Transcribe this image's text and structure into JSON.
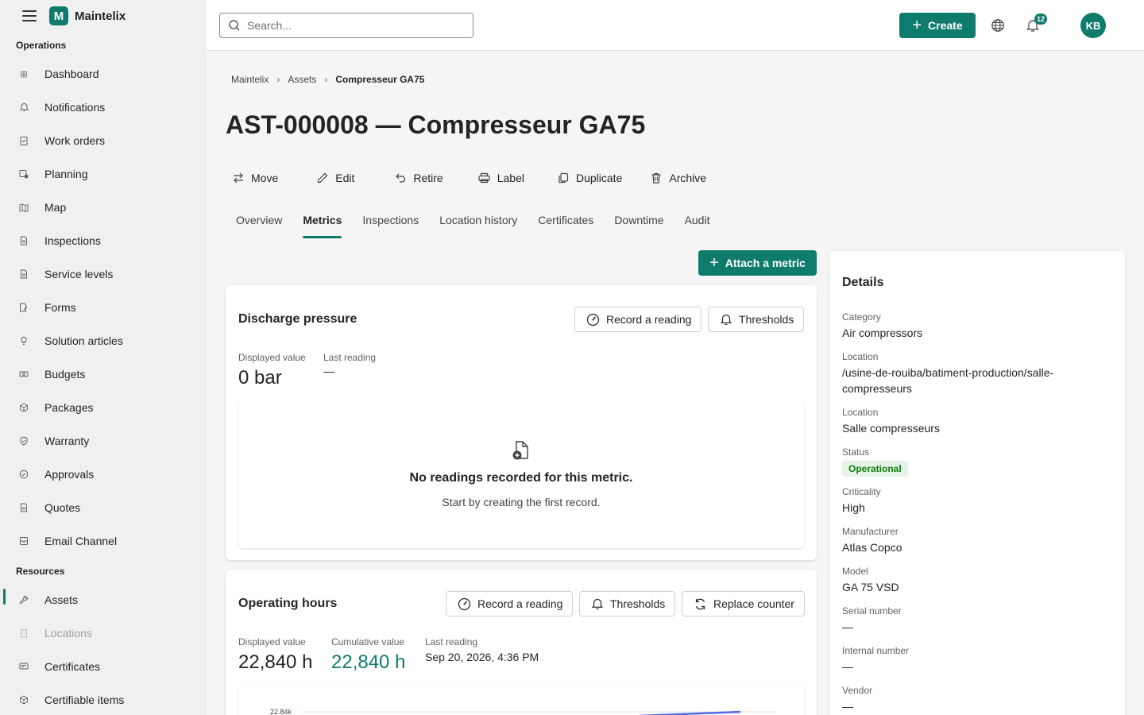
{
  "app": {
    "name": "Maintelix"
  },
  "sidebar": {
    "sections": [
      {
        "label": "Operations"
      },
      {
        "label": "Resources"
      }
    ],
    "operations": [
      {
        "label": "Dashboard",
        "icon": "dashboard-icon"
      },
      {
        "label": "Notifications",
        "icon": "bell-icon"
      },
      {
        "label": "Work orders",
        "icon": "clipboard-icon"
      },
      {
        "label": "Planning",
        "icon": "calendar-icon"
      },
      {
        "label": "Map",
        "icon": "map-icon"
      },
      {
        "label": "Inspections",
        "icon": "document-icon"
      },
      {
        "label": "Service levels",
        "icon": "document-icon"
      },
      {
        "label": "Forms",
        "icon": "form-icon"
      },
      {
        "label": "Solution articles",
        "icon": "lightbulb-icon"
      },
      {
        "label": "Budgets",
        "icon": "money-icon"
      },
      {
        "label": "Packages",
        "icon": "box-icon"
      },
      {
        "label": "Warranty",
        "icon": "shield-icon"
      },
      {
        "label": "Approvals",
        "icon": "check-circle-icon"
      },
      {
        "label": "Quotes",
        "icon": "document-icon"
      },
      {
        "label": "Email Channel",
        "icon": "mail-icon"
      }
    ],
    "resources": [
      {
        "label": "Assets",
        "icon": "wrench-icon",
        "active": true
      },
      {
        "label": "Locations",
        "icon": "building-icon",
        "disabled": true
      },
      {
        "label": "Certificates",
        "icon": "certificate-icon"
      },
      {
        "label": "Certifiable items",
        "icon": "box-icon"
      }
    ]
  },
  "topbar": {
    "search_placeholder": "Search...",
    "create_label": "Create",
    "notifications_count": "12",
    "avatar_initials": "KB"
  },
  "breadcrumb": [
    "Maintelix",
    "Assets",
    "Compresseur GA75"
  ],
  "page_title": "AST-000008 — Compresseur GA75",
  "actions": [
    {
      "label": "Move",
      "icon": "arrows-icon"
    },
    {
      "label": "Edit",
      "icon": "pencil-icon"
    },
    {
      "label": "Retire",
      "icon": "undo-icon"
    },
    {
      "label": "Label",
      "icon": "printer-icon"
    },
    {
      "label": "Duplicate",
      "icon": "copy-icon"
    },
    {
      "label": "Archive",
      "icon": "trash-icon"
    }
  ],
  "tabs": [
    {
      "label": "Overview"
    },
    {
      "label": "Metrics",
      "active": true
    },
    {
      "label": "Inspections"
    },
    {
      "label": "Location history"
    },
    {
      "label": "Certificates"
    },
    {
      "label": "Downtime"
    },
    {
      "label": "Audit"
    }
  ],
  "attach_metric_label": "Attach a metric",
  "metrics": {
    "discharge": {
      "title": "Discharge pressure",
      "record_label": "Record a reading",
      "thresholds_label": "Thresholds",
      "displayed_label": "Displayed value",
      "displayed_value": "0 bar",
      "last_label": "Last reading",
      "last_value": "—",
      "empty_title": "No readings recorded for this metric.",
      "empty_sub": "Start by creating the first record."
    },
    "hours": {
      "title": "Operating hours",
      "record_label": "Record a reading",
      "thresholds_label": "Thresholds",
      "replace_label": "Replace counter",
      "displayed_label": "Displayed value",
      "displayed_value": "22,840 h",
      "cumulative_label": "Cumulative value",
      "cumulative_value": "22,840 h",
      "last_label": "Last reading",
      "last_value": "Sep 20, 2026, 4:36 PM",
      "chart_tick": "22.84k"
    }
  },
  "details": {
    "title": "Details",
    "fields": [
      {
        "label": "Category",
        "value": "Air compressors"
      },
      {
        "label": "Location",
        "value": "/usine-de-rouiba/batiment-production/salle-compresseurs"
      },
      {
        "label": "Location",
        "value": "Salle compresseurs"
      },
      {
        "label": "Status",
        "value": "Operational"
      },
      {
        "label": "Criticality",
        "value": "High"
      },
      {
        "label": "Manufacturer",
        "value": "Atlas Copco"
      },
      {
        "label": "Model",
        "value": "GA 75 VSD"
      },
      {
        "label": "Serial number",
        "value": "—"
      },
      {
        "label": "Internal number",
        "value": "—"
      },
      {
        "label": "Vendor",
        "value": "—"
      }
    ]
  },
  "colors": {
    "accent": "#0f7b6c",
    "status_bg": "#e6f4e8",
    "status_fg": "#107c10",
    "chart_line": "#4f6bed"
  }
}
